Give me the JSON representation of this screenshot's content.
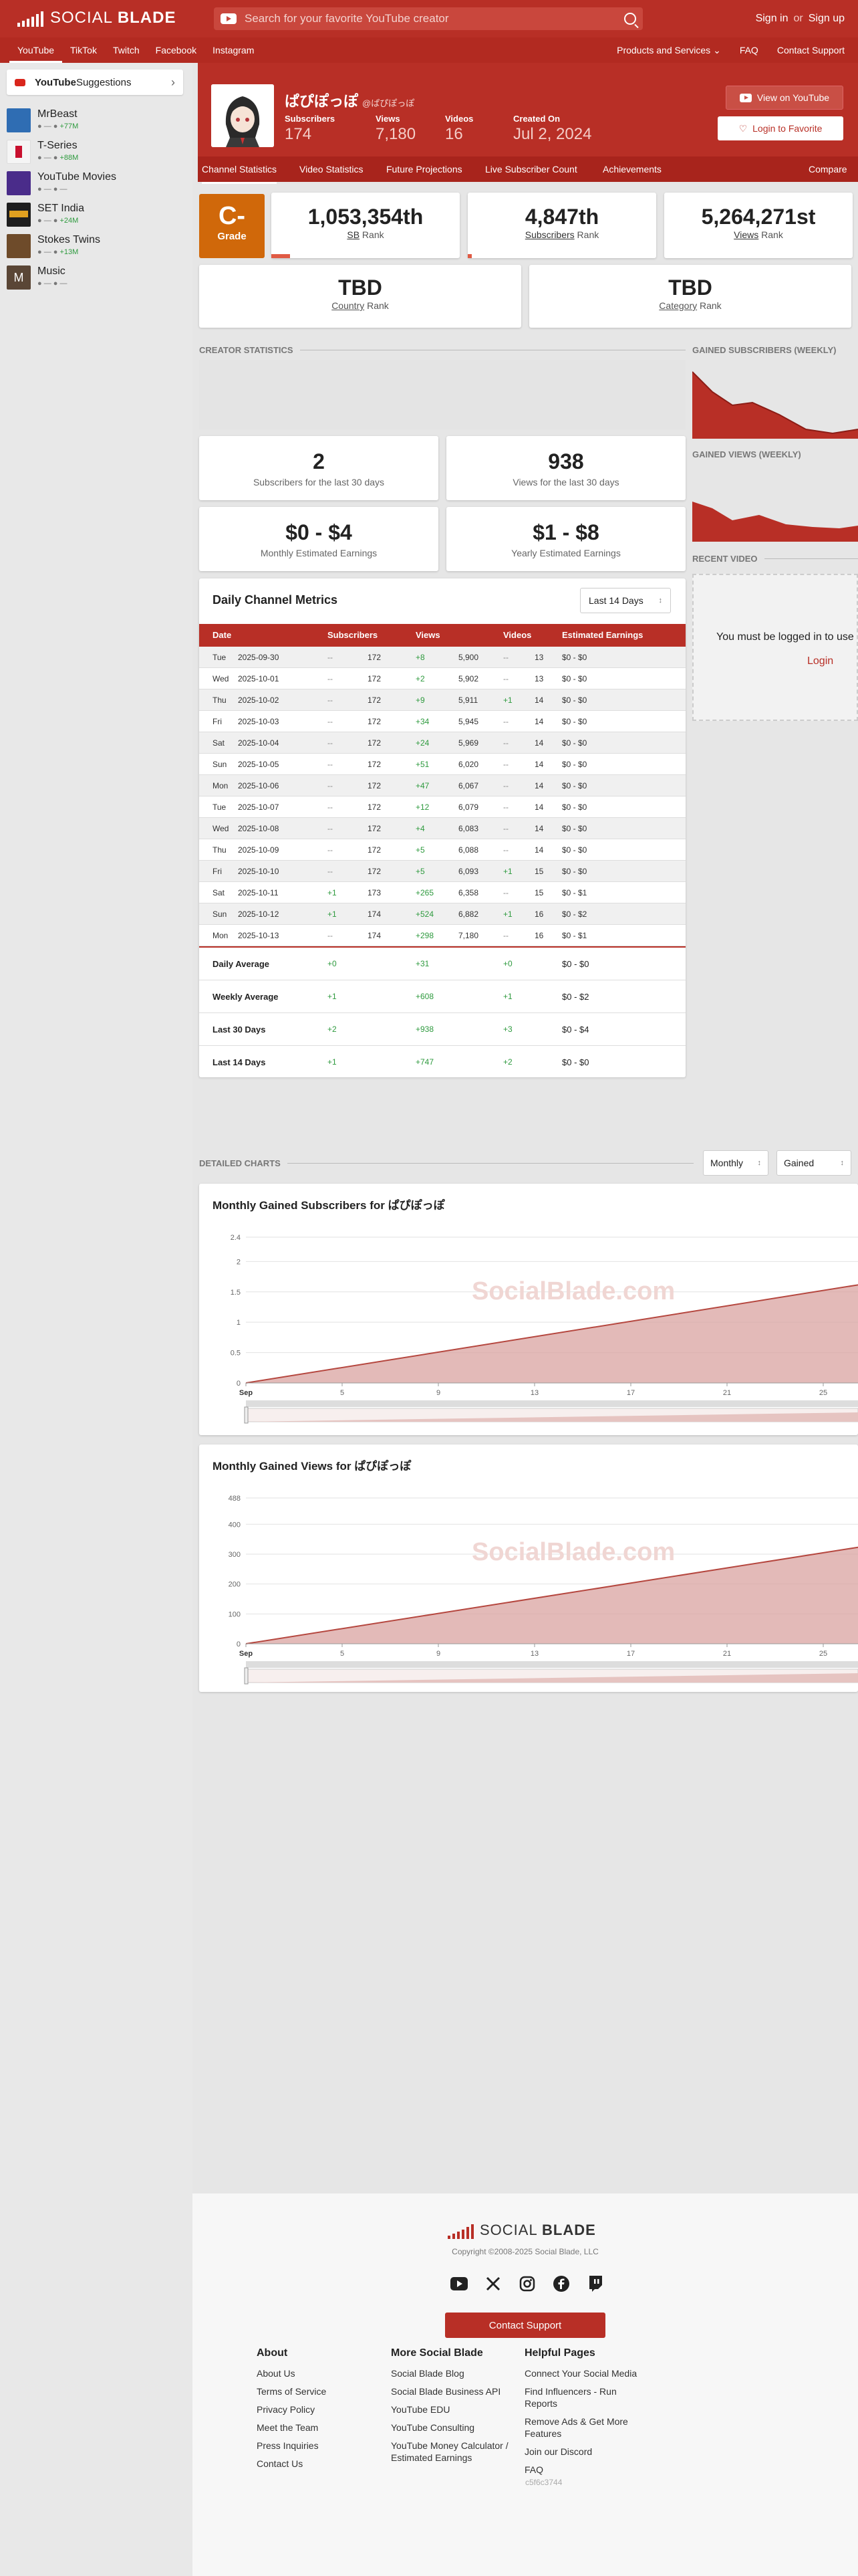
{
  "header": {
    "logo_word1": "SOCIAL ",
    "logo_word2": "BLADE",
    "search_placeholder": "Search for your favorite YouTube creator",
    "sign_in": "Sign in",
    "or": "or",
    "sign_up": "Sign up"
  },
  "nav": {
    "platforms": [
      "YouTube",
      "TikTok",
      "Twitch",
      "Facebook",
      "Instagram"
    ],
    "products": "Products and Services",
    "faq": "FAQ",
    "contact": "Contact Support"
  },
  "sidebar": {
    "title_bold": "YouTube",
    "title_rest": " Suggestions",
    "items": [
      {
        "name": "MrBeast",
        "meta": "+77M",
        "color": "#2f6db3"
      },
      {
        "name": "T-Series",
        "meta": "+88M",
        "color": "#c8102e"
      },
      {
        "name": "YouTube Movies",
        "meta": "—",
        "color": "#4a2c8a"
      },
      {
        "name": "SET India",
        "meta": "+24M",
        "color": "#1e1e1e"
      },
      {
        "name": "Stokes Twins",
        "meta": "+13M",
        "color": "#6e4b2a"
      },
      {
        "name": "Music",
        "meta": "—",
        "color": "#5a4636"
      }
    ]
  },
  "profile": {
    "name": "ぱぴぽっぽ",
    "handle": "@ぱぴぽっぽ",
    "stats": [
      {
        "label": "Subscribers",
        "value": "174"
      },
      {
        "label": "Views",
        "value": "7,180"
      },
      {
        "label": "Videos",
        "value": "16"
      },
      {
        "label": "Created On",
        "value": "Jul 2, 2024"
      }
    ],
    "view_on_youtube": "View on YouTube",
    "login_favorite": "Login to Favorite"
  },
  "subtabs": [
    "Channel Statistics",
    "Video Statistics",
    "Future Projections",
    "Live Subscriber Count",
    "Achievements"
  ],
  "compare": "Compare",
  "grade": {
    "value": "C-",
    "label": "Grade"
  },
  "ranks": [
    {
      "value": "1,053,354th",
      "label_u": "SB",
      "label": " Rank",
      "fill": 0.1
    },
    {
      "value": "4,847th",
      "label_u": "Subscribers",
      "label": " Rank",
      "fill": 0.02
    },
    {
      "value": "5,264,271st",
      "label_u": "Views",
      "label": " Rank",
      "fill": 0
    }
  ],
  "tbd": [
    {
      "value": "TBD",
      "label_u": "Country",
      "label": " Rank"
    },
    {
      "value": "TBD",
      "label_u": "Category",
      "label": " Rank"
    }
  ],
  "sections": {
    "creator_stats": "CREATOR STATISTICS",
    "gained_subs_weekly": "GAINED SUBSCRIBERS (WEEKLY)",
    "gained_views_weekly": "GAINED VIEWS (WEEKLY)",
    "recent_video": "RECENT VIDEO",
    "detailed_charts": "DETAILED CHARTS"
  },
  "stat_cards": [
    {
      "big": "2",
      "sub": "Subscribers for the last 30 days"
    },
    {
      "big": "938",
      "sub": "Views for the last 30 days"
    },
    {
      "big": "$0 - $4",
      "sub": "Monthly Estimated Earnings"
    },
    {
      "big": "$1 - $8",
      "sub": "Yearly Estimated Earnings"
    }
  ],
  "metrics": {
    "title": "Daily Channel Metrics",
    "range": "Last 14 Days",
    "headers": [
      "Date",
      "Subscribers",
      "Views",
      "Videos",
      "Estimated Earnings"
    ],
    "rows": [
      [
        "Tue",
        "2025-09-30",
        "--",
        "172",
        "+8",
        "5,900",
        "--",
        "13",
        "$0 - $0"
      ],
      [
        "Wed",
        "2025-10-01",
        "--",
        "172",
        "+2",
        "5,902",
        "--",
        "13",
        "$0 - $0"
      ],
      [
        "Thu",
        "2025-10-02",
        "--",
        "172",
        "+9",
        "5,911",
        "+1",
        "14",
        "$0 - $0"
      ],
      [
        "Fri",
        "2025-10-03",
        "--",
        "172",
        "+34",
        "5,945",
        "--",
        "14",
        "$0 - $0"
      ],
      [
        "Sat",
        "2025-10-04",
        "--",
        "172",
        "+24",
        "5,969",
        "--",
        "14",
        "$0 - $0"
      ],
      [
        "Sun",
        "2025-10-05",
        "--",
        "172",
        "+51",
        "6,020",
        "--",
        "14",
        "$0 - $0"
      ],
      [
        "Mon",
        "2025-10-06",
        "--",
        "172",
        "+47",
        "6,067",
        "--",
        "14",
        "$0 - $0"
      ],
      [
        "Tue",
        "2025-10-07",
        "--",
        "172",
        "+12",
        "6,079",
        "--",
        "14",
        "$0 - $0"
      ],
      [
        "Wed",
        "2025-10-08",
        "--",
        "172",
        "+4",
        "6,083",
        "--",
        "14",
        "$0 - $0"
      ],
      [
        "Thu",
        "2025-10-09",
        "--",
        "172",
        "+5",
        "6,088",
        "--",
        "14",
        "$0 - $0"
      ],
      [
        "Fri",
        "2025-10-10",
        "--",
        "172",
        "+5",
        "6,093",
        "+1",
        "15",
        "$0 - $0"
      ],
      [
        "Sat",
        "2025-10-11",
        "+1",
        "173",
        "+265",
        "6,358",
        "--",
        "15",
        "$0 - $1"
      ],
      [
        "Sun",
        "2025-10-12",
        "+1",
        "174",
        "+524",
        "6,882",
        "+1",
        "16",
        "$0 - $2"
      ],
      [
        "Mon",
        "2025-10-13",
        "--",
        "174",
        "+298",
        "7,180",
        "--",
        "16",
        "$0 - $1"
      ]
    ],
    "averages": [
      {
        "name": "Daily Average",
        "subs": "+0",
        "views": "+31",
        "videos": "+0",
        "earn": "$0 - $0"
      },
      {
        "name": "Weekly Average",
        "subs": "+1",
        "views": "+608",
        "videos": "+1",
        "earn": "$0 - $2"
      },
      {
        "name": "Last 30 Days",
        "subs": "+2",
        "views": "+938",
        "videos": "+3",
        "earn": "$0 - $4"
      },
      {
        "name": "Last 14 Days",
        "subs": "+1",
        "views": "+747",
        "videos": "+2",
        "earn": "$0 - $0"
      }
    ]
  },
  "recent": {
    "message": "You must be logged in to use",
    "login": "Login"
  },
  "detailed": {
    "period": "Monthly",
    "mode": "Gained"
  },
  "watermark": "SocialBlade.com",
  "chart_data": [
    {
      "type": "area",
      "title": "Monthly Gained Subscribers for ぱぴぽっぽ",
      "ylim": [
        0,
        2.4
      ],
      "yticks": [
        "0",
        "0.5",
        "1",
        "1.5",
        "2",
        "2.4"
      ],
      "xticks": [
        "Sep",
        "5",
        "9",
        "13",
        "17",
        "21",
        "25"
      ],
      "x": [
        0,
        26
      ],
      "values": [
        0,
        1.65
      ],
      "color": "#d9a3a0"
    },
    {
      "type": "area",
      "title": "Monthly Gained Views for ぱぴぽっぽ",
      "ylim": [
        0,
        488
      ],
      "yticks": [
        "0",
        "100",
        "200",
        "300",
        "400",
        "488"
      ],
      "xticks": [
        "Sep",
        "5",
        "9",
        "13",
        "17",
        "21",
        "25"
      ],
      "x": [
        0,
        26
      ],
      "values": [
        0,
        330
      ],
      "color": "#d9a3a0"
    }
  ],
  "footer": {
    "copyright": "Copyright ©2008-2025 Social Blade, LLC",
    "contact": "Contact Support",
    "hash": "c5f6c3744",
    "columns": [
      {
        "title": "About",
        "links": [
          "About Us",
          "Terms of Service",
          "Privacy Policy",
          "Meet the Team",
          "Press Inquiries",
          "Contact Us"
        ]
      },
      {
        "title": "More Social Blade",
        "links": [
          "Social Blade Blog",
          "Social Blade Business API",
          "YouTube EDU",
          "YouTube Consulting",
          "YouTube Money Calculator / Estimated Earnings"
        ]
      },
      {
        "title": "Helpful Pages",
        "links": [
          "Connect Your Social Media",
          "Find Influencers - Run Reports",
          "Remove Ads & Get More Features",
          "Join our Discord",
          "FAQ"
        ]
      }
    ]
  }
}
